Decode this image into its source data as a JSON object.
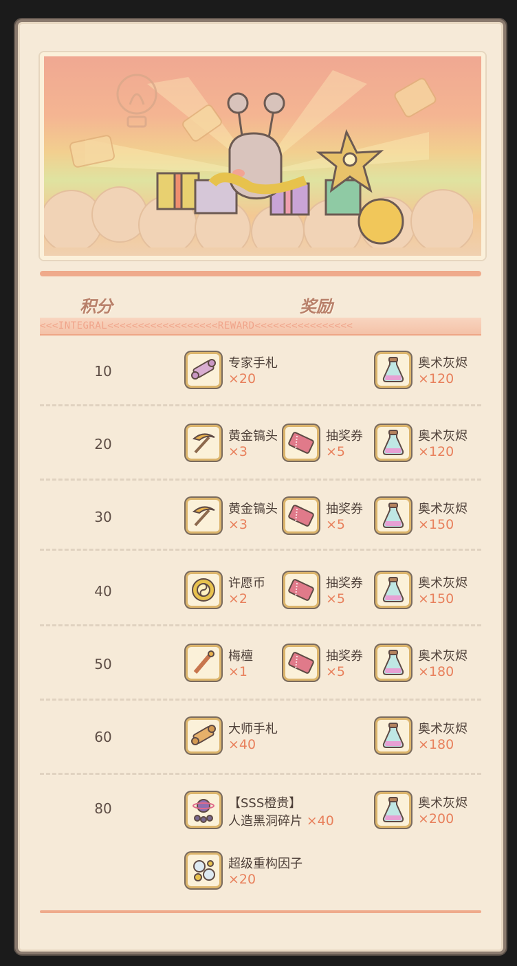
{
  "header": {
    "points_label": "积分",
    "reward_label": "奖励"
  },
  "ribbon_text": "<<<INTEGRAL<<<<<<<<<<<<<<<<<<REWARD<<<<<<<<<<<<<<<<",
  "rows": [
    {
      "points": "10",
      "items": [
        {
          "icon": "scroll-icon",
          "name": "专家手札",
          "qty": "×20"
        },
        {
          "icon": "potion-icon",
          "name": "奥术灰烬",
          "qty": "×120"
        }
      ]
    },
    {
      "points": "20",
      "items": [
        {
          "icon": "pickaxe-icon",
          "name": "黄金镐头",
          "qty": "×3"
        },
        {
          "icon": "ticket-icon",
          "name": "抽奖券",
          "qty": "×5"
        },
        {
          "icon": "potion-icon",
          "name": "奥术灰烬",
          "qty": "×120"
        }
      ]
    },
    {
      "points": "30",
      "items": [
        {
          "icon": "pickaxe-icon",
          "name": "黄金镐头",
          "qty": "×3"
        },
        {
          "icon": "ticket-icon",
          "name": "抽奖券",
          "qty": "×5"
        },
        {
          "icon": "potion-icon",
          "name": "奥术灰烬",
          "qty": "×150"
        }
      ]
    },
    {
      "points": "40",
      "items": [
        {
          "icon": "coin-icon",
          "name": "许愿币",
          "qty": "×2"
        },
        {
          "icon": "ticket-icon",
          "name": "抽奖券",
          "qty": "×5"
        },
        {
          "icon": "potion-icon",
          "name": "奥术灰烬",
          "qty": "×150"
        }
      ]
    },
    {
      "points": "50",
      "items": [
        {
          "icon": "wand-icon",
          "name": "梅檀",
          "qty": "×1"
        },
        {
          "icon": "ticket-icon",
          "name": "抽奖券",
          "qty": "×5"
        },
        {
          "icon": "potion-icon",
          "name": "奥术灰烬",
          "qty": "×180"
        }
      ]
    },
    {
      "points": "60",
      "items": [
        {
          "icon": "scroll-icon",
          "name": "大师手札",
          "qty": "×40"
        },
        {
          "icon": "potion-icon",
          "name": "奥术灰烬",
          "qty": "×180"
        }
      ]
    },
    {
      "points": "80",
      "items": [
        {
          "icon": "blackhole-icon",
          "name": "【SSS橙贵】",
          "name2": "人造黑洞碎片",
          "qty": "×40"
        },
        {
          "icon": "potion-icon",
          "name": "奥术灰烬",
          "qty": "×200"
        },
        {
          "icon": "factor-icon",
          "name": "超级重构因子",
          "qty": "×20"
        }
      ]
    }
  ]
}
